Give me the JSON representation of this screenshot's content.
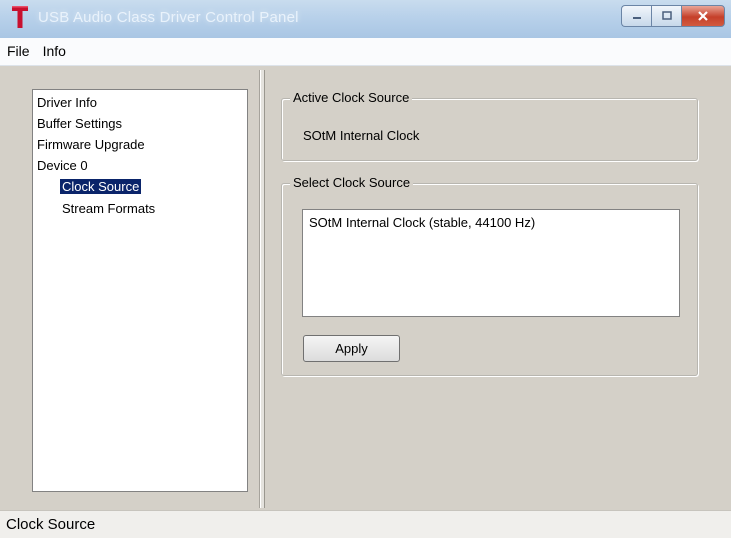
{
  "window": {
    "title": "USB Audio Class Driver Control Panel"
  },
  "menu": {
    "items": [
      "File",
      "Info"
    ]
  },
  "nav": {
    "items": [
      {
        "label": "Driver Info"
      },
      {
        "label": "Buffer Settings"
      },
      {
        "label": "Firmware Upgrade"
      },
      {
        "label": "Device 0"
      },
      {
        "label": "Clock Source",
        "selected": true
      },
      {
        "label": "Stream Formats"
      }
    ]
  },
  "active_clock": {
    "legend": "Active Clock Source",
    "value": "SOtM Internal Clock"
  },
  "select_clock": {
    "legend": "Select Clock Source",
    "options": [
      "SOtM Internal Clock (stable, 44100 Hz)"
    ],
    "apply_label": "Apply"
  },
  "status": {
    "text": "Clock Source"
  },
  "colors": {
    "selection": "#0a246a",
    "close_button": "#c5402a",
    "app_icon": "#c8102e"
  },
  "icons": [
    "app-t-logo-icon",
    "minimize-icon",
    "maximize-icon",
    "close-icon"
  ]
}
